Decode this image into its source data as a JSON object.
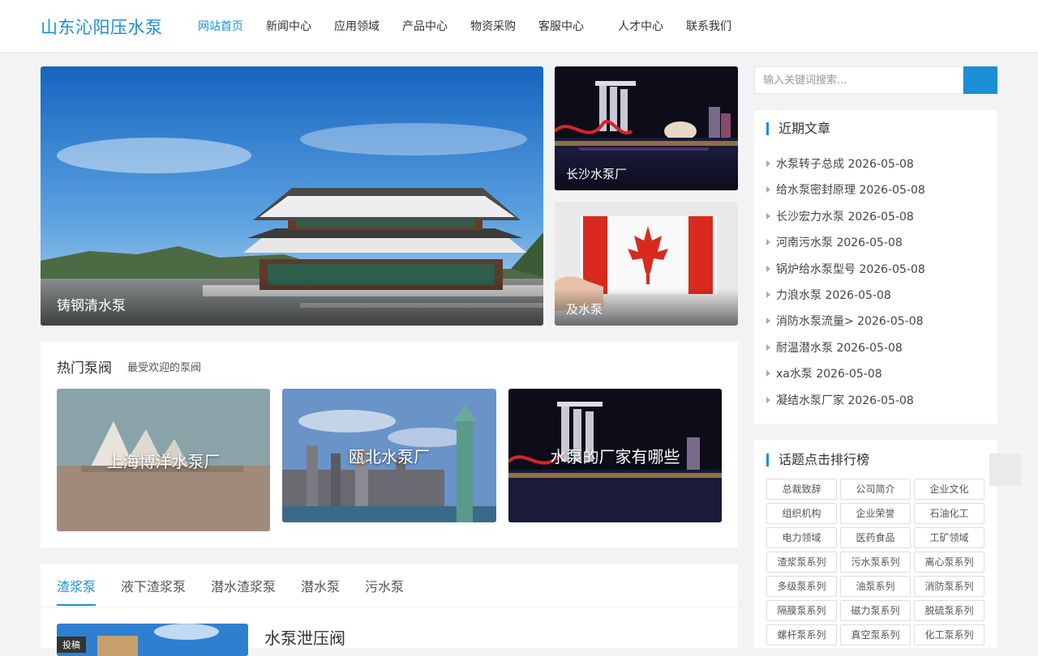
{
  "site": {
    "logo": "山东沁阳压水泵"
  },
  "nav": [
    "网站首页",
    "新闻中心",
    "应用领域",
    "产品中心",
    "物资采购",
    "客服中心",
    "人才中心",
    "联系我们"
  ],
  "slider": {
    "main_caption": "铸钢清水泵",
    "side1_caption": "长沙水泵厂",
    "side2_caption": "及水泵"
  },
  "hot": {
    "title": "热门泵阀",
    "subtitle": "最受欢迎的泵阀",
    "items": [
      "上海博洋水泵厂",
      "瓯北水泵厂",
      "水泵的厂家有哪些"
    ]
  },
  "tabs": [
    "渣浆泵",
    "液下渣浆泵",
    "潜水渣浆泵",
    "潜水泵",
    "污水泵"
  ],
  "article": {
    "badge": "投稿",
    "title": "水泵泄压阀"
  },
  "search": {
    "placeholder": "输入关键词搜索..."
  },
  "recent": {
    "title": "近期文章",
    "items": [
      "水泵转子总成 2026-05-08",
      "给水泵密封原理 2026-05-08",
      "长沙宏力水泵 2026-05-08",
      "河南污水泵 2026-05-08",
      "锅炉给水泵型号 2026-05-08",
      "力浪水泵 2026-05-08",
      "消防水泵流量> 2026-05-08",
      "耐温潜水泵 2026-05-08",
      "xa水泵 2026-05-08",
      "凝结水泵厂家 2026-05-08"
    ]
  },
  "ranking": {
    "title": "话题点击排行榜",
    "tags": [
      "总裁致辞",
      "公司简介",
      "企业文化",
      "组织机构",
      "企业荣誉",
      "石油化工",
      "电力领域",
      "医药食品",
      "工矿领域",
      "渣浆泵系列",
      "污水泵系列",
      "离心泵系列",
      "多级泵系列",
      "油泵系列",
      "消防泵系列",
      "隔膜泵系列",
      "磁力泵系列",
      "脱硫泵系列",
      "螺杆泵系列",
      "真空泵系列",
      "化工泵系列"
    ]
  },
  "colors": {
    "accent": "#1a8fd5",
    "background": "#f3f3f3"
  }
}
